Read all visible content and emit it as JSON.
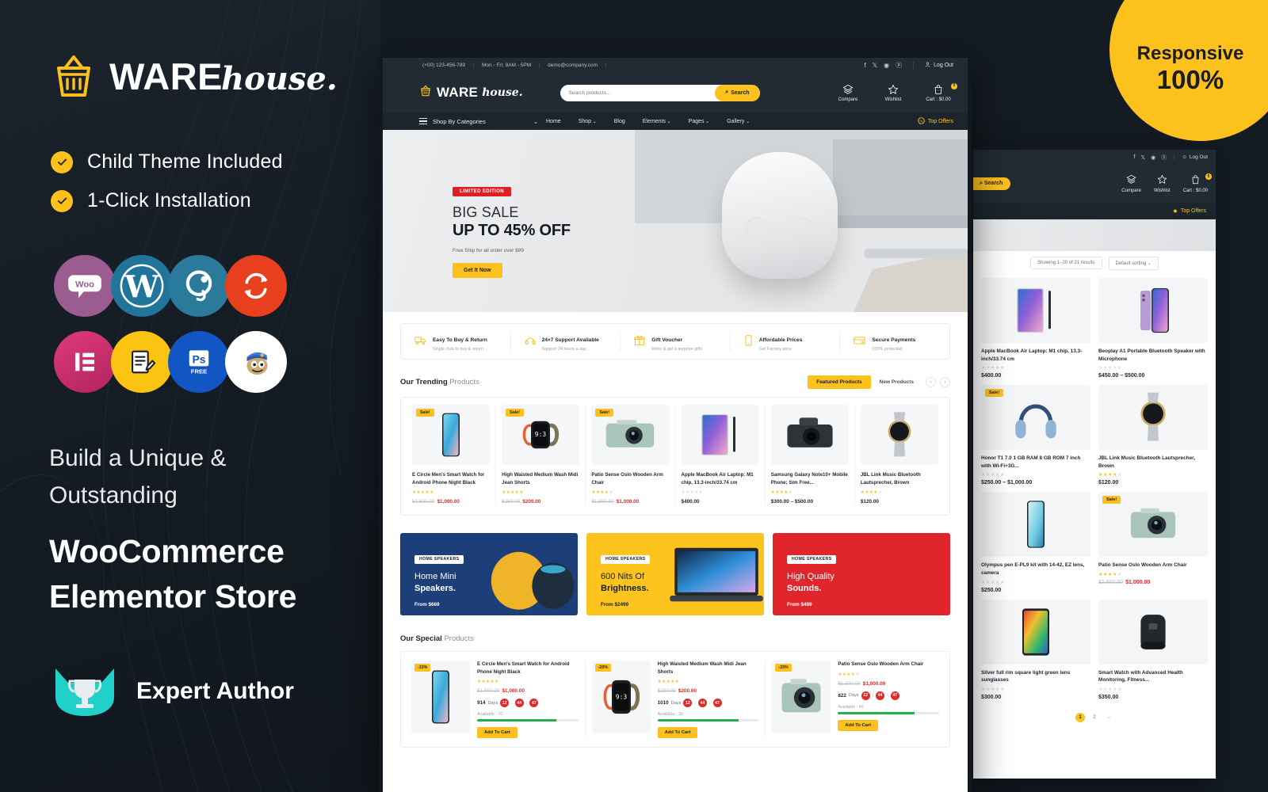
{
  "left": {
    "logo": {
      "ware": "WARE",
      "house": "house.",
      "icon": "shopping-basket-icon"
    },
    "bullets": [
      {
        "label": "Child Theme Included",
        "icon": "check-circle-icon"
      },
      {
        "label": "1-Click Installation",
        "icon": "check-circle-icon"
      }
    ],
    "tech_icons": [
      {
        "name": "woocommerce-icon",
        "label": "Woo",
        "color": "#9b5c8f"
      },
      {
        "name": "wordpress-icon",
        "label": "W",
        "color": "#21759b"
      },
      {
        "name": "jquery-icon",
        "label": "Q",
        "color": "#2a7b9b"
      },
      {
        "name": "revolution-slider-icon",
        "label": "↻",
        "color": "#e8401f"
      },
      {
        "name": "elementor-icon",
        "label": "E",
        "color": "#d9317a"
      },
      {
        "name": "contact-form-icon",
        "label": "✎",
        "color": "#fbc412"
      },
      {
        "name": "photoshop-free-icon",
        "label": "Ps",
        "sub": "FREE",
        "color": "#1256c4"
      },
      {
        "name": "mailchimp-icon",
        "label": "🐵",
        "color": "#ffffff"
      }
    ],
    "headline_small": "Build a Unique &\nOutstanding",
    "headline_large": "WooCommerce\nElementor Store",
    "expert": {
      "label": "Expert Author",
      "icon": "envato-trophy-icon",
      "color": "#1fd1c8"
    }
  },
  "responsive_badge": {
    "line1": "Responsive",
    "line2": "100%",
    "color": "#fcc11c"
  },
  "desktop": {
    "topbar": {
      "phone": "(+00) 123-456-789",
      "hours": "Mon - Fri: 8AM - 5PM",
      "email": "demo@company.com",
      "socials": [
        "facebook-icon",
        "twitter-icon",
        "instagram-icon",
        "pinterest-icon"
      ],
      "login": "Log Out",
      "login_icon": "user-icon"
    },
    "header": {
      "logo_ware": "WARE",
      "logo_house": "house.",
      "search_placeholder": "Search products...",
      "search_value": "",
      "search_button": "Search",
      "search_icon": "magnifier-icon",
      "utils": [
        {
          "label": "Compare",
          "icon": "layers-icon"
        },
        {
          "label": "Wishlist",
          "icon": "star-icon"
        },
        {
          "label": "Cart : $0.00",
          "icon": "bag-icon",
          "badge": "0"
        }
      ]
    },
    "nav": {
      "categories": "Shop By Categories",
      "menu": [
        "Home",
        "Shop",
        "Blog",
        "Elements",
        "Pages",
        "Gallery"
      ],
      "menu_caret": [
        false,
        true,
        false,
        true,
        true,
        true
      ],
      "top_offers": "Top Offers",
      "top_offers_icon": "discount-badge-icon"
    },
    "hero": {
      "badge": "LIMITED EDITION",
      "title1": "BIG SALE",
      "title2": "UP TO 45% OFF",
      "subtitle": "Free Ship for all order over $99",
      "button": "Get It Now"
    },
    "features": [
      {
        "icon": "truck-icon",
        "title": "Easy To Buy & Return",
        "sub": "Single click to buy & return."
      },
      {
        "icon": "headset-icon",
        "title": "24×7 Support Available",
        "sub": "Support 24 hours a day."
      },
      {
        "icon": "gift-icon",
        "title": "Gift Voucher",
        "sub": "Refer & get a surprise gifts."
      },
      {
        "icon": "mobile-icon",
        "title": "Affordable Prices",
        "sub": "Get Factory price"
      },
      {
        "icon": "credit-card-icon",
        "title": "Secure Payments",
        "sub": "100% protected"
      }
    ],
    "trending": {
      "title_bold": "Our Trending",
      "title_light": "Products",
      "tab_active": "Featured Products",
      "tab_inactive": "New Products",
      "products": [
        {
          "badge": "Sale!",
          "title": "E Circle Men's Smart Watch for Android Phone Night Black",
          "stars": 5,
          "old": "$1,500.00",
          "new": "$1,000.00",
          "art": "phone-blue"
        },
        {
          "badge": "Sale!",
          "title": "High Waisted Medium Wash Midi Jean Shorts",
          "stars": 5,
          "old": "$250.00",
          "new": "$200.00",
          "art": "watch-orange"
        },
        {
          "badge": "Sale!",
          "title": "Patio Sense Oslo Wooden Arm Chair",
          "stars": 4,
          "old": "$1,500.00",
          "new": "$1,000.00",
          "art": "camera-green"
        },
        {
          "badge": "",
          "title": "Apple MacBook Air Laptop: M1 chip, 13.3-inch/33.74 cm",
          "stars": 0,
          "old": "",
          "new": "",
          "price": "$400.00",
          "art": "tablet-purple"
        },
        {
          "badge": "",
          "title": "Samsung Galaxy Note10+ Mobile Phone; Sim Free...",
          "stars": 4,
          "old": "",
          "new": "",
          "price": "$300.00 – $500.00",
          "art": "camera-black"
        },
        {
          "badge": "",
          "title": "JBL Link Music Bluetooth Lautsprecher, Brown",
          "stars": 4,
          "old": "",
          "new": "",
          "price": "$120.00",
          "art": "watch-silver"
        }
      ]
    },
    "promos": [
      {
        "tag": "HOME SPEAKERS",
        "line1": "Home Mini",
        "line2": "Speakers.",
        "from": "From $669",
        "bg": "#1c3f79",
        "art": "speaker-pair"
      },
      {
        "tag": "HOME SPEAKERS",
        "line1": "600 Nits Of",
        "line2": "Brightness.",
        "from": "From $2499",
        "bg": "#fcc41c",
        "art": "laptop",
        "dark": true
      },
      {
        "tag": "HOME SPEAKERS",
        "line1": "High Quality",
        "line2": "Sounds.",
        "from": "From $499",
        "bg": "#e0262c",
        "art": "headphones"
      }
    ],
    "special": {
      "title_bold": "Our Special",
      "title_light": "Products",
      "items": [
        {
          "discount": "-33%",
          "title": "E Circle Men's Smart Watch for Android Phone Night Black",
          "stars": 5,
          "old": "$1,500.00",
          "new": "$1,000.00",
          "days": "914",
          "days_label": "Days",
          "cd": [
            "12",
            "44",
            "47"
          ],
          "available": "Available : 70",
          "progress": 78,
          "button": "Add To Cart",
          "art": "phone-blue"
        },
        {
          "discount": "-20%",
          "title": "High Waisted Medium Wash Midi Jean Shorts",
          "stars": 5,
          "old": "$250.00",
          "new": "$200.00",
          "days": "1010",
          "days_label": "Days",
          "cd": [
            "12",
            "44",
            "47"
          ],
          "available": "Available : 30",
          "progress": 80,
          "button": "Add To Cart",
          "art": "watch-orange"
        },
        {
          "discount": "-33%",
          "title": "Patio Sense Oslo Wooden Arm Chair",
          "stars": 4,
          "old": "$1,500.00",
          "new": "$1,000.00",
          "days": "822",
          "days_label": "Days",
          "cd": [
            "12",
            "44",
            "47"
          ],
          "available": "Available : 40",
          "progress": 76,
          "button": "Add To Cart",
          "art": "camera-green"
        }
      ]
    }
  },
  "tablet": {
    "topbar": {
      "socials": [
        "facebook-icon",
        "twitter-icon",
        "instagram-icon",
        "pinterest-icon"
      ],
      "login": "Log Out"
    },
    "search_button": "Search",
    "utils": [
      {
        "label": "Compare",
        "icon": "layers-icon"
      },
      {
        "label": "Wishlist",
        "icon": "star-icon"
      },
      {
        "label": "Cart : $0.00",
        "icon": "bag-icon",
        "badge": "0"
      }
    ],
    "top_offers": "Top Offers",
    "results": "Showing 1–20 of 21 results",
    "sorting": "Default sorting",
    "products": [
      {
        "badge": "",
        "title": "Apple MacBook Air Laptop: M1 chip, 13.3-inch/33.74 cm",
        "stars": 0,
        "price": "$400.00",
        "art": "tablet-purple"
      },
      {
        "badge": "",
        "title": "Beoplay A1 Portable Bluetooth Speaker with Microphone",
        "stars": 0,
        "price": "$450.00 – $500.00",
        "art": "phone-purple"
      },
      {
        "badge": "Sale!",
        "title": "Honor T1 7.0 1 GB RAM 8 GB ROM 7 inch with Wi-Fi+3G...",
        "stars": 0,
        "price": "$250.00 – $1,000.00",
        "art": "headphones-blue"
      },
      {
        "badge": "",
        "title": "JBL Link Music Bluetooth Lautsprecher, Brown",
        "stars": 4,
        "price": "$120.00",
        "art": "watch-silver"
      },
      {
        "badge": "",
        "title": "Olympus pen E-PL9 kit with 14-42, EZ lens, camera",
        "stars": 0,
        "price": "$250.00",
        "art": "phone-teal"
      },
      {
        "badge": "Sale!",
        "title": "Patio Sense Oslo Wooden Arm Chair",
        "stars": 4,
        "old": "$1,500.00",
        "new": "$1,000.00",
        "art": "camera-green"
      },
      {
        "badge": "",
        "title": "Silver full rim square light green lens sunglasses",
        "stars": 0,
        "price": "$300.00",
        "art": "tablet-color"
      },
      {
        "badge": "",
        "title": "Smart Watch with Advanced Health Monitoring, Fitness...",
        "stars": 0,
        "price": "$350.00",
        "art": "speaker-black"
      }
    ],
    "pager": [
      "1",
      "2",
      "→"
    ]
  }
}
